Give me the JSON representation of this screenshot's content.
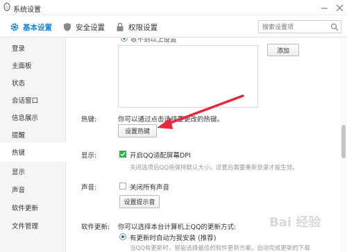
{
  "window": {
    "title": "系统设置"
  },
  "tabs": [
    {
      "label": "基本设置",
      "icon": "gear-icon",
      "active": true
    },
    {
      "label": "安全设置",
      "icon": "shield-icon",
      "active": false
    },
    {
      "label": "权限设置",
      "icon": "lock-icon",
      "active": false
    }
  ],
  "search": {
    "placeholder": "搜索设置项"
  },
  "sidebar": {
    "items": [
      "登录",
      "主面板",
      "状态",
      "会话窗口",
      "信息展示",
      "提醒",
      "热键",
      "显示",
      "声音",
      "软件更新",
      "文件管理"
    ],
    "active": "热键"
  },
  "content": {
    "top_option_partial": "收不到以上设置",
    "add_button": "添加",
    "hotkey": {
      "label": "热键:",
      "text": "你可以通过点击选择要更改的热键。",
      "button": "设置热键"
    },
    "display": {
      "label": "显示:",
      "checkbox_label": "开启QQ适配屏幕DPI",
      "checked": true,
      "hint": "关闭选项后QQ将保持默认大小，设置后需要重新登录才能生效。"
    },
    "sound": {
      "label": "声音:",
      "checkbox_label": "关闭所有声音",
      "checked": false,
      "button": "设置提示音"
    },
    "update": {
      "label": "软件更新:",
      "text": "你可以选择本台计算机上QQ的更新方式:",
      "radio_label": "有更新时自动为我安装 (推荐)",
      "hint": "当QQ有更新时，智能选择最佳的软件更新方案，自动完成更新的下载"
    }
  },
  "watermark": "Bai 经验",
  "colors": {
    "accent": "#1a84d8",
    "check": "#2bb24c",
    "arrow": "#e8283c"
  }
}
